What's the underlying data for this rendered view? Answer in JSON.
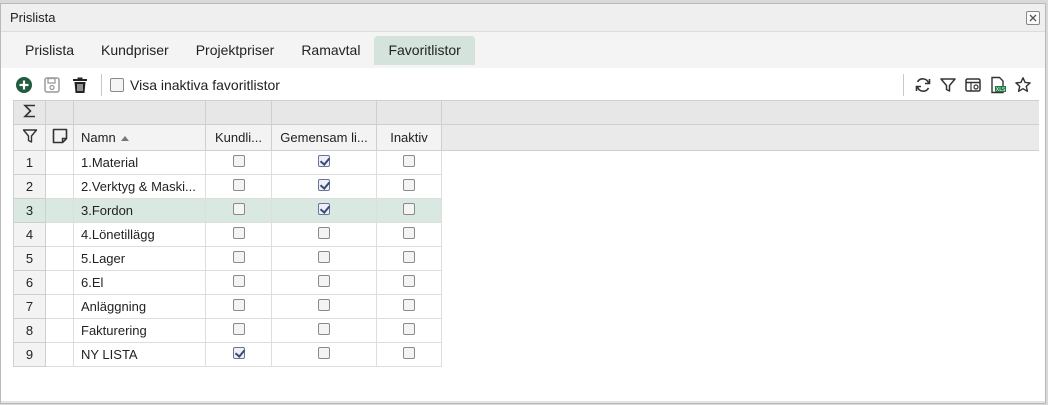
{
  "window": {
    "title": "Prislista"
  },
  "tabs": [
    {
      "label": "Prislista"
    },
    {
      "label": "Kundpriser"
    },
    {
      "label": "Projektpriser"
    },
    {
      "label": "Ramavtal"
    },
    {
      "label": "Favoritlistor"
    }
  ],
  "toolbar": {
    "show_inactive_label": "Visa inaktiva favoritlistor",
    "show_inactive_checked": false
  },
  "grid": {
    "columns": {
      "name": "Namn",
      "kundlista": "Kundli...",
      "gemensam": "Gemensam li...",
      "inaktiv": "Inaktiv"
    },
    "rows": [
      {
        "num": "1",
        "name": "1.Material",
        "kundlista": false,
        "gemensam": true,
        "inaktiv": false
      },
      {
        "num": "2",
        "name": "2.Verktyg & Maski...",
        "kundlista": false,
        "gemensam": true,
        "inaktiv": false
      },
      {
        "num": "3",
        "name": "3.Fordon",
        "kundlista": false,
        "gemensam": true,
        "inaktiv": false
      },
      {
        "num": "4",
        "name": "4.Lönetillägg",
        "kundlista": false,
        "gemensam": false,
        "inaktiv": false
      },
      {
        "num": "5",
        "name": "5.Lager",
        "kundlista": false,
        "gemensam": false,
        "inaktiv": false
      },
      {
        "num": "6",
        "name": "6.El",
        "kundlista": false,
        "gemensam": false,
        "inaktiv": false
      },
      {
        "num": "7",
        "name": "Anläggning",
        "kundlista": false,
        "gemensam": false,
        "inaktiv": false
      },
      {
        "num": "8",
        "name": "Fakturering",
        "kundlista": false,
        "gemensam": false,
        "inaktiv": false
      },
      {
        "num": "9",
        "name": "NY LISTA",
        "kundlista": true,
        "gemensam": false,
        "inaktiv": false
      }
    ],
    "selected_row": "3"
  },
  "colors": {
    "active_tab": "#d4e3dc",
    "selected_row": "#d9e8e0",
    "add_icon": "#1f5b3f"
  }
}
